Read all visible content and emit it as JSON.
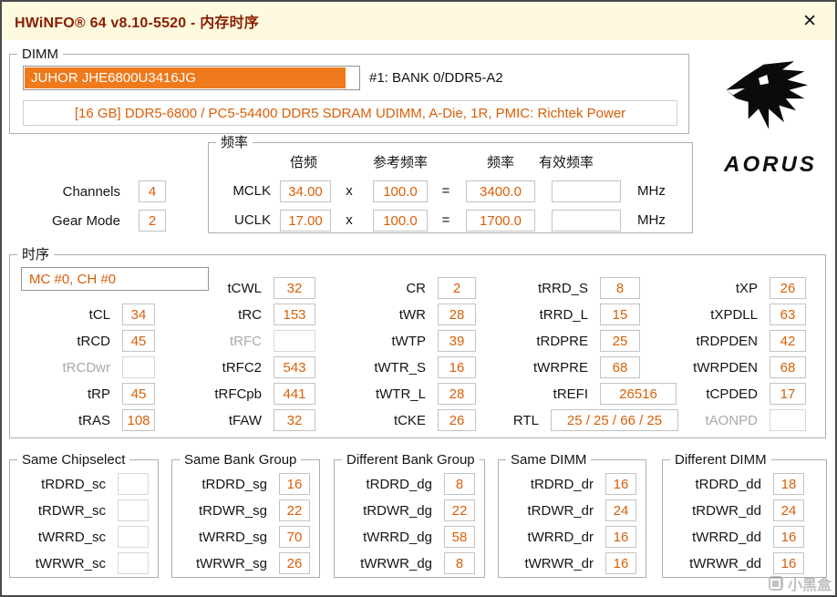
{
  "window": {
    "title": "HWiNFO® 64 v8.10-5520 - 内存时序",
    "close_glyph": "✕"
  },
  "colors": {
    "accent_orange": "#D95F08",
    "title_red": "#8B1E00",
    "highlight_orange": "#EE7A1C",
    "titlebar_bg": "#FDFADF"
  },
  "brand": {
    "name": "AORUS"
  },
  "dimm": {
    "label": "DIMM",
    "module": "JUHOR JHE6800U3416JG",
    "slot": "#1: BANK 0/DDR5-A2",
    "description": "[16 GB] DDR5-6800 / PC5-54400 DDR5 SDRAM UDIMM, A-Die, 1R, PMIC: Richtek Power"
  },
  "stats": {
    "channels_label": "Channels",
    "channels_value": "4",
    "gear_label": "Gear Mode",
    "gear_value": "2"
  },
  "frequency": {
    "label": "频率",
    "headers": {
      "mult": "倍频",
      "ref": "参考频率",
      "freq": "频率",
      "eff": "有效频率"
    },
    "mul_sign": "x",
    "eq_sign": "=",
    "unit": "MHz",
    "rows": [
      {
        "name": "MCLK",
        "mult": "34.00",
        "ref": "100.0",
        "freq": "3400.0",
        "eff": ""
      },
      {
        "name": "UCLK",
        "mult": "17.00",
        "ref": "100.0",
        "freq": "1700.0",
        "eff": ""
      }
    ]
  },
  "timings": {
    "label": "时序",
    "selector": "MC #0, CH #0",
    "col1": [
      {
        "l": "tCL",
        "v": "34"
      },
      {
        "l": "tRCD",
        "v": "45"
      },
      {
        "l": "tRCDwr",
        "v": "",
        "disabled": true
      },
      {
        "l": "tRP",
        "v": "45"
      },
      {
        "l": "tRAS",
        "v": "108"
      }
    ],
    "col2": [
      {
        "l": "tCWL",
        "v": "32"
      },
      {
        "l": "tRC",
        "v": "153"
      },
      {
        "l": "tRFC",
        "v": "",
        "disabled": true
      },
      {
        "l": "tRFC2",
        "v": "543"
      },
      {
        "l": "tRFCpb",
        "v": "441"
      },
      {
        "l": "tFAW",
        "v": "32"
      }
    ],
    "col3": [
      {
        "l": "CR",
        "v": "2"
      },
      {
        "l": "tWR",
        "v": "28"
      },
      {
        "l": "tWTP",
        "v": "39"
      },
      {
        "l": "tWTR_S",
        "v": "16"
      },
      {
        "l": "tWTR_L",
        "v": "28"
      },
      {
        "l": "tCKE",
        "v": "26"
      }
    ],
    "col4": [
      {
        "l": "tRRD_S",
        "v": "8"
      },
      {
        "l": "tRRD_L",
        "v": "15"
      },
      {
        "l": "tRDPRE",
        "v": "25"
      },
      {
        "l": "tWRPRE",
        "v": "68"
      },
      {
        "l": "tREFI",
        "v": "26516"
      },
      {
        "l": "RTL",
        "v": "25 / 25 / 66 / 25"
      }
    ],
    "col5": [
      {
        "l": "tXP",
        "v": "26"
      },
      {
        "l": "tXPDLL",
        "v": "63"
      },
      {
        "l": "tRDPDEN",
        "v": "42"
      },
      {
        "l": "tWRPDEN",
        "v": "68"
      },
      {
        "l": "tCPDED",
        "v": "17"
      },
      {
        "l": "tAONPD",
        "v": "",
        "disabled": true
      }
    ]
  },
  "groups": {
    "sc": {
      "label": "Same Chipselect",
      "rows": [
        {
          "l": "tRDRD_sc",
          "v": "",
          "disabled": true
        },
        {
          "l": "tRDWR_sc",
          "v": "",
          "disabled": true
        },
        {
          "l": "tWRRD_sc",
          "v": "",
          "disabled": true
        },
        {
          "l": "tWRWR_sc",
          "v": "",
          "disabled": true
        }
      ]
    },
    "sg": {
      "label": "Same Bank Group",
      "rows": [
        {
          "l": "tRDRD_sg",
          "v": "16"
        },
        {
          "l": "tRDWR_sg",
          "v": "22"
        },
        {
          "l": "tWRRD_sg",
          "v": "70"
        },
        {
          "l": "tWRWR_sg",
          "v": "26"
        }
      ]
    },
    "dg": {
      "label": "Different Bank Group",
      "rows": [
        {
          "l": "tRDRD_dg",
          "v": "8"
        },
        {
          "l": "tRDWR_dg",
          "v": "22"
        },
        {
          "l": "tWRRD_dg",
          "v": "58"
        },
        {
          "l": "tWRWR_dg",
          "v": "8"
        }
      ]
    },
    "dr": {
      "label": "Same DIMM",
      "rows": [
        {
          "l": "tRDRD_dr",
          "v": "16"
        },
        {
          "l": "tRDWR_dr",
          "v": "24"
        },
        {
          "l": "tWRRD_dr",
          "v": "16"
        },
        {
          "l": "tWRWR_dr",
          "v": "16"
        }
      ]
    },
    "dd": {
      "label": "Different DIMM",
      "rows": [
        {
          "l": "tRDRD_dd",
          "v": "18"
        },
        {
          "l": "tRDWR_dd",
          "v": "24"
        },
        {
          "l": "tWRRD_dd",
          "v": "16"
        },
        {
          "l": "tWRWR_dd",
          "v": "16"
        }
      ]
    }
  },
  "watermark": {
    "text": "小黑盒"
  }
}
